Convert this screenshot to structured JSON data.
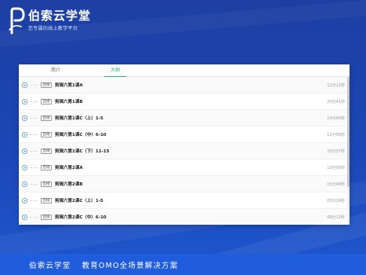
{
  "brand": {
    "name": "伯索云学堂",
    "slogan": "您专属的线上教学平台",
    "logo_icon": "p-logo-icon"
  },
  "tabs": [
    {
      "label": "简介",
      "active": false
    },
    {
      "label": "大纲",
      "active": true
    }
  ],
  "lesson_badge": "直播",
  "lessons": [
    {
      "title": "剪辑六第1课A",
      "duration": "12分12秒"
    },
    {
      "title": "剪辑六第1课B",
      "duration": "20分41秒"
    },
    {
      "title": "剪辑六第1课C（上）1-5",
      "duration": "14分40秒"
    },
    {
      "title": "剪辑六第1课C（中）6-10",
      "duration": "12分58秒"
    },
    {
      "title": "剪辑六第1课C（下）11-15",
      "duration": "10分37秒"
    },
    {
      "title": "剪辑六第2课A",
      "duration": "13分56秒"
    },
    {
      "title": "剪辑六第2课B",
      "duration": "15分48秒"
    },
    {
      "title": "剪辑六第2课C（上）1-5",
      "duration": "05分29秒"
    },
    {
      "title": "剪辑六第2课C（中）6-10",
      "duration": "08分12秒"
    }
  ],
  "footer": {
    "brand": "伯索云学堂",
    "slogan": "教育OMO全场景解决方案"
  },
  "colors": {
    "accent": "#2bb07a",
    "background": "#1b47b6",
    "footer": "#1f5ddc",
    "play_icon": "#4a8df0"
  }
}
